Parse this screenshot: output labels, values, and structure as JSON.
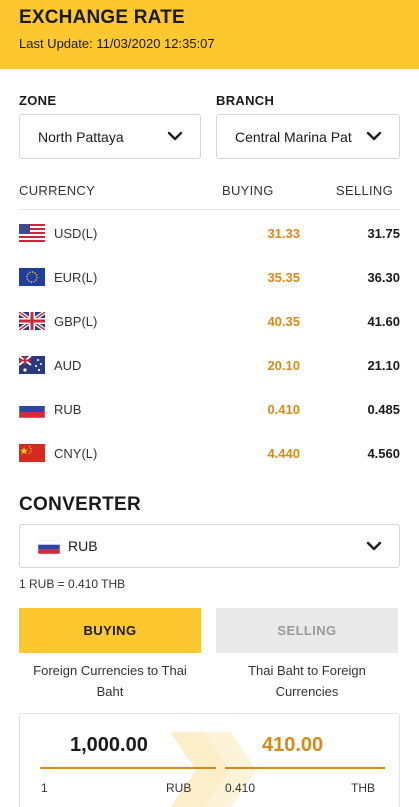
{
  "header": {
    "title": "EXCHANGE RATE",
    "last_update": "Last Update: 11/03/2020 12:35:07"
  },
  "filters": {
    "zone": {
      "label": "ZONE",
      "value": "North Pattaya",
      "icon": "chevron-down-icon"
    },
    "branch": {
      "label": "BRANCH",
      "value": "Central Marina Pat",
      "icon": "chevron-down-icon"
    }
  },
  "table": {
    "headers": {
      "currency": "CURRENCY",
      "buying": "BUYING",
      "selling": "SELLING"
    },
    "rows": [
      {
        "code": "USD(L)",
        "buying": "31.33",
        "selling": "31.75",
        "flag": "us-flag-icon"
      },
      {
        "code": "EUR(L)",
        "buying": "35.35",
        "selling": "36.30",
        "flag": "eu-flag-icon"
      },
      {
        "code": "GBP(L)",
        "buying": "40.35",
        "selling": "41.60",
        "flag": "uk-flag-icon"
      },
      {
        "code": "AUD",
        "buying": "20.10",
        "selling": "21.10",
        "flag": "au-flag-icon"
      },
      {
        "code": "RUB",
        "buying": "0.410",
        "selling": "0.485",
        "flag": "ru-flag-icon"
      },
      {
        "code": "CNY(L)",
        "buying": "4.440",
        "selling": "4.560",
        "flag": "cn-flag-icon"
      }
    ]
  },
  "converter": {
    "title": "CONVERTER",
    "selected_currency": "RUB",
    "selected_flag": "ru-flag-icon",
    "rate_note": "1 RUB = 0.410 THB",
    "tabs": {
      "buying": {
        "label": "BUYING",
        "desc": "Foreign Currencies to Thai Baht"
      },
      "selling": {
        "label": "SELLING",
        "desc": "Thai Baht to Foreign Currencies"
      }
    },
    "calc": {
      "from_amount": "1,000.00",
      "to_amount": "410.00",
      "from_unit_rate": "1",
      "from_currency": "RUB",
      "to_unit_rate": "0.410",
      "to_currency": "THB"
    }
  },
  "colors": {
    "brand_yellow": "#fdc82f",
    "buying_value": "#d68a1a",
    "inactive_tab": "#e9e9e9"
  }
}
